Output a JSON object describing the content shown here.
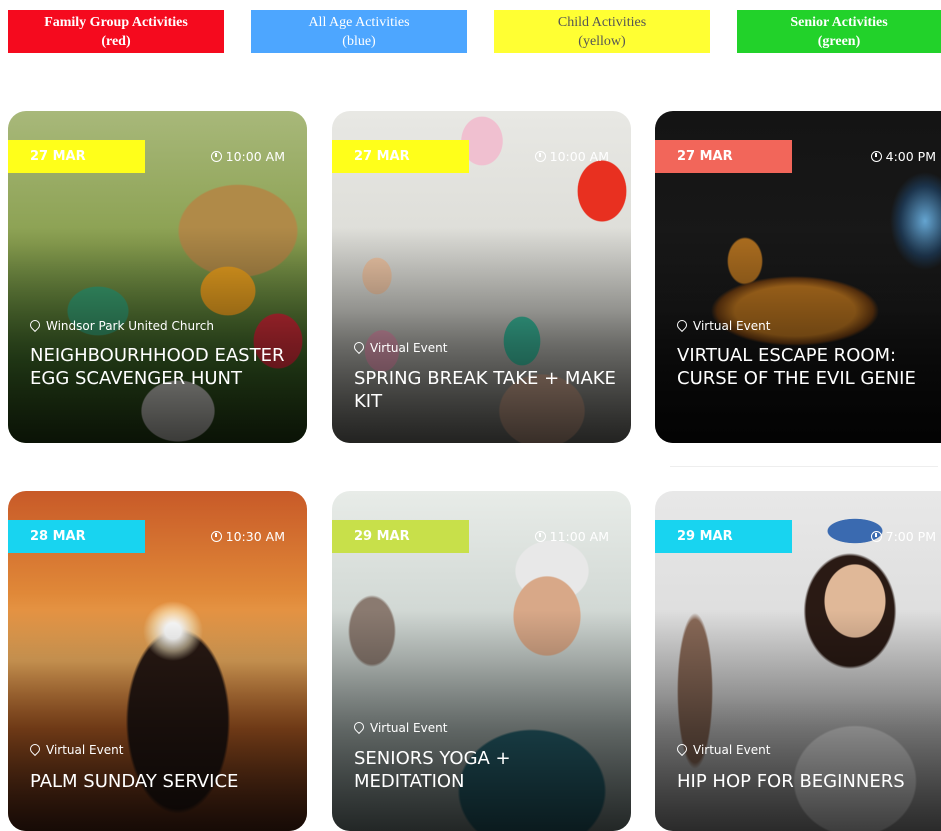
{
  "legend": [
    {
      "line1": "Family Group Activities",
      "line2": "(red)",
      "bg": "#f50a1e",
      "fg": "#ffffff",
      "bold": true
    },
    {
      "line1": "All Age Activities",
      "line2": "(blue)",
      "bg": "#4da6ff",
      "fg": "#ffffff",
      "bold": false
    },
    {
      "line1": "Child Activities",
      "line2": "(yellow)",
      "bg": "#ffff33",
      "fg": "#555555",
      "bold": false
    },
    {
      "line1": "Senior Activities",
      "line2": "(green)",
      "bg": "#22d22a",
      "fg": "#ffffff",
      "bold": true
    }
  ],
  "events": [
    {
      "date": "27 MAR",
      "time": "10:00 AM",
      "location": "Windsor Park United Church",
      "title": "NEIGHBOURHHOOD EASTER EGG SCAVENGER HUNT",
      "badge_color": "#ffff1a",
      "image": "easter-basket-photo"
    },
    {
      "date": "27 MAR",
      "time": "10:00 AM",
      "location": "Virtual Event",
      "title": "SPRING BREAK TAKE + MAKE KIT",
      "badge_color": "#ffff1a",
      "image": "craft-eggs-photo"
    },
    {
      "date": "27 MAR",
      "time": "4:00 PM",
      "location": "Virtual Event",
      "title": "VIRTUAL ESCAPE ROOM: CURSE OF THE EVIL GENIE",
      "badge_color": "#f2665a",
      "image": "magic-lamp-photo"
    },
    {
      "date": "28 MAR",
      "time": "10:30 AM",
      "location": "Virtual Event",
      "title": "PALM SUNDAY SERVICE",
      "badge_color": "#18d4f0",
      "image": "hands-cross-sunset-photo"
    },
    {
      "date": "29 MAR",
      "time": "11:00 AM",
      "location": "Virtual Event",
      "title": "SENIORS YOGA + MEDITATION",
      "badge_color": "#c8e04a",
      "image": "senior-yoga-photo"
    },
    {
      "date": "29 MAR",
      "time": "7:00 PM",
      "location": "Virtual Event",
      "title": "HIP HOP FOR BEGINNERS",
      "badge_color": "#18d4f0",
      "image": "girl-dancer-photo"
    }
  ]
}
